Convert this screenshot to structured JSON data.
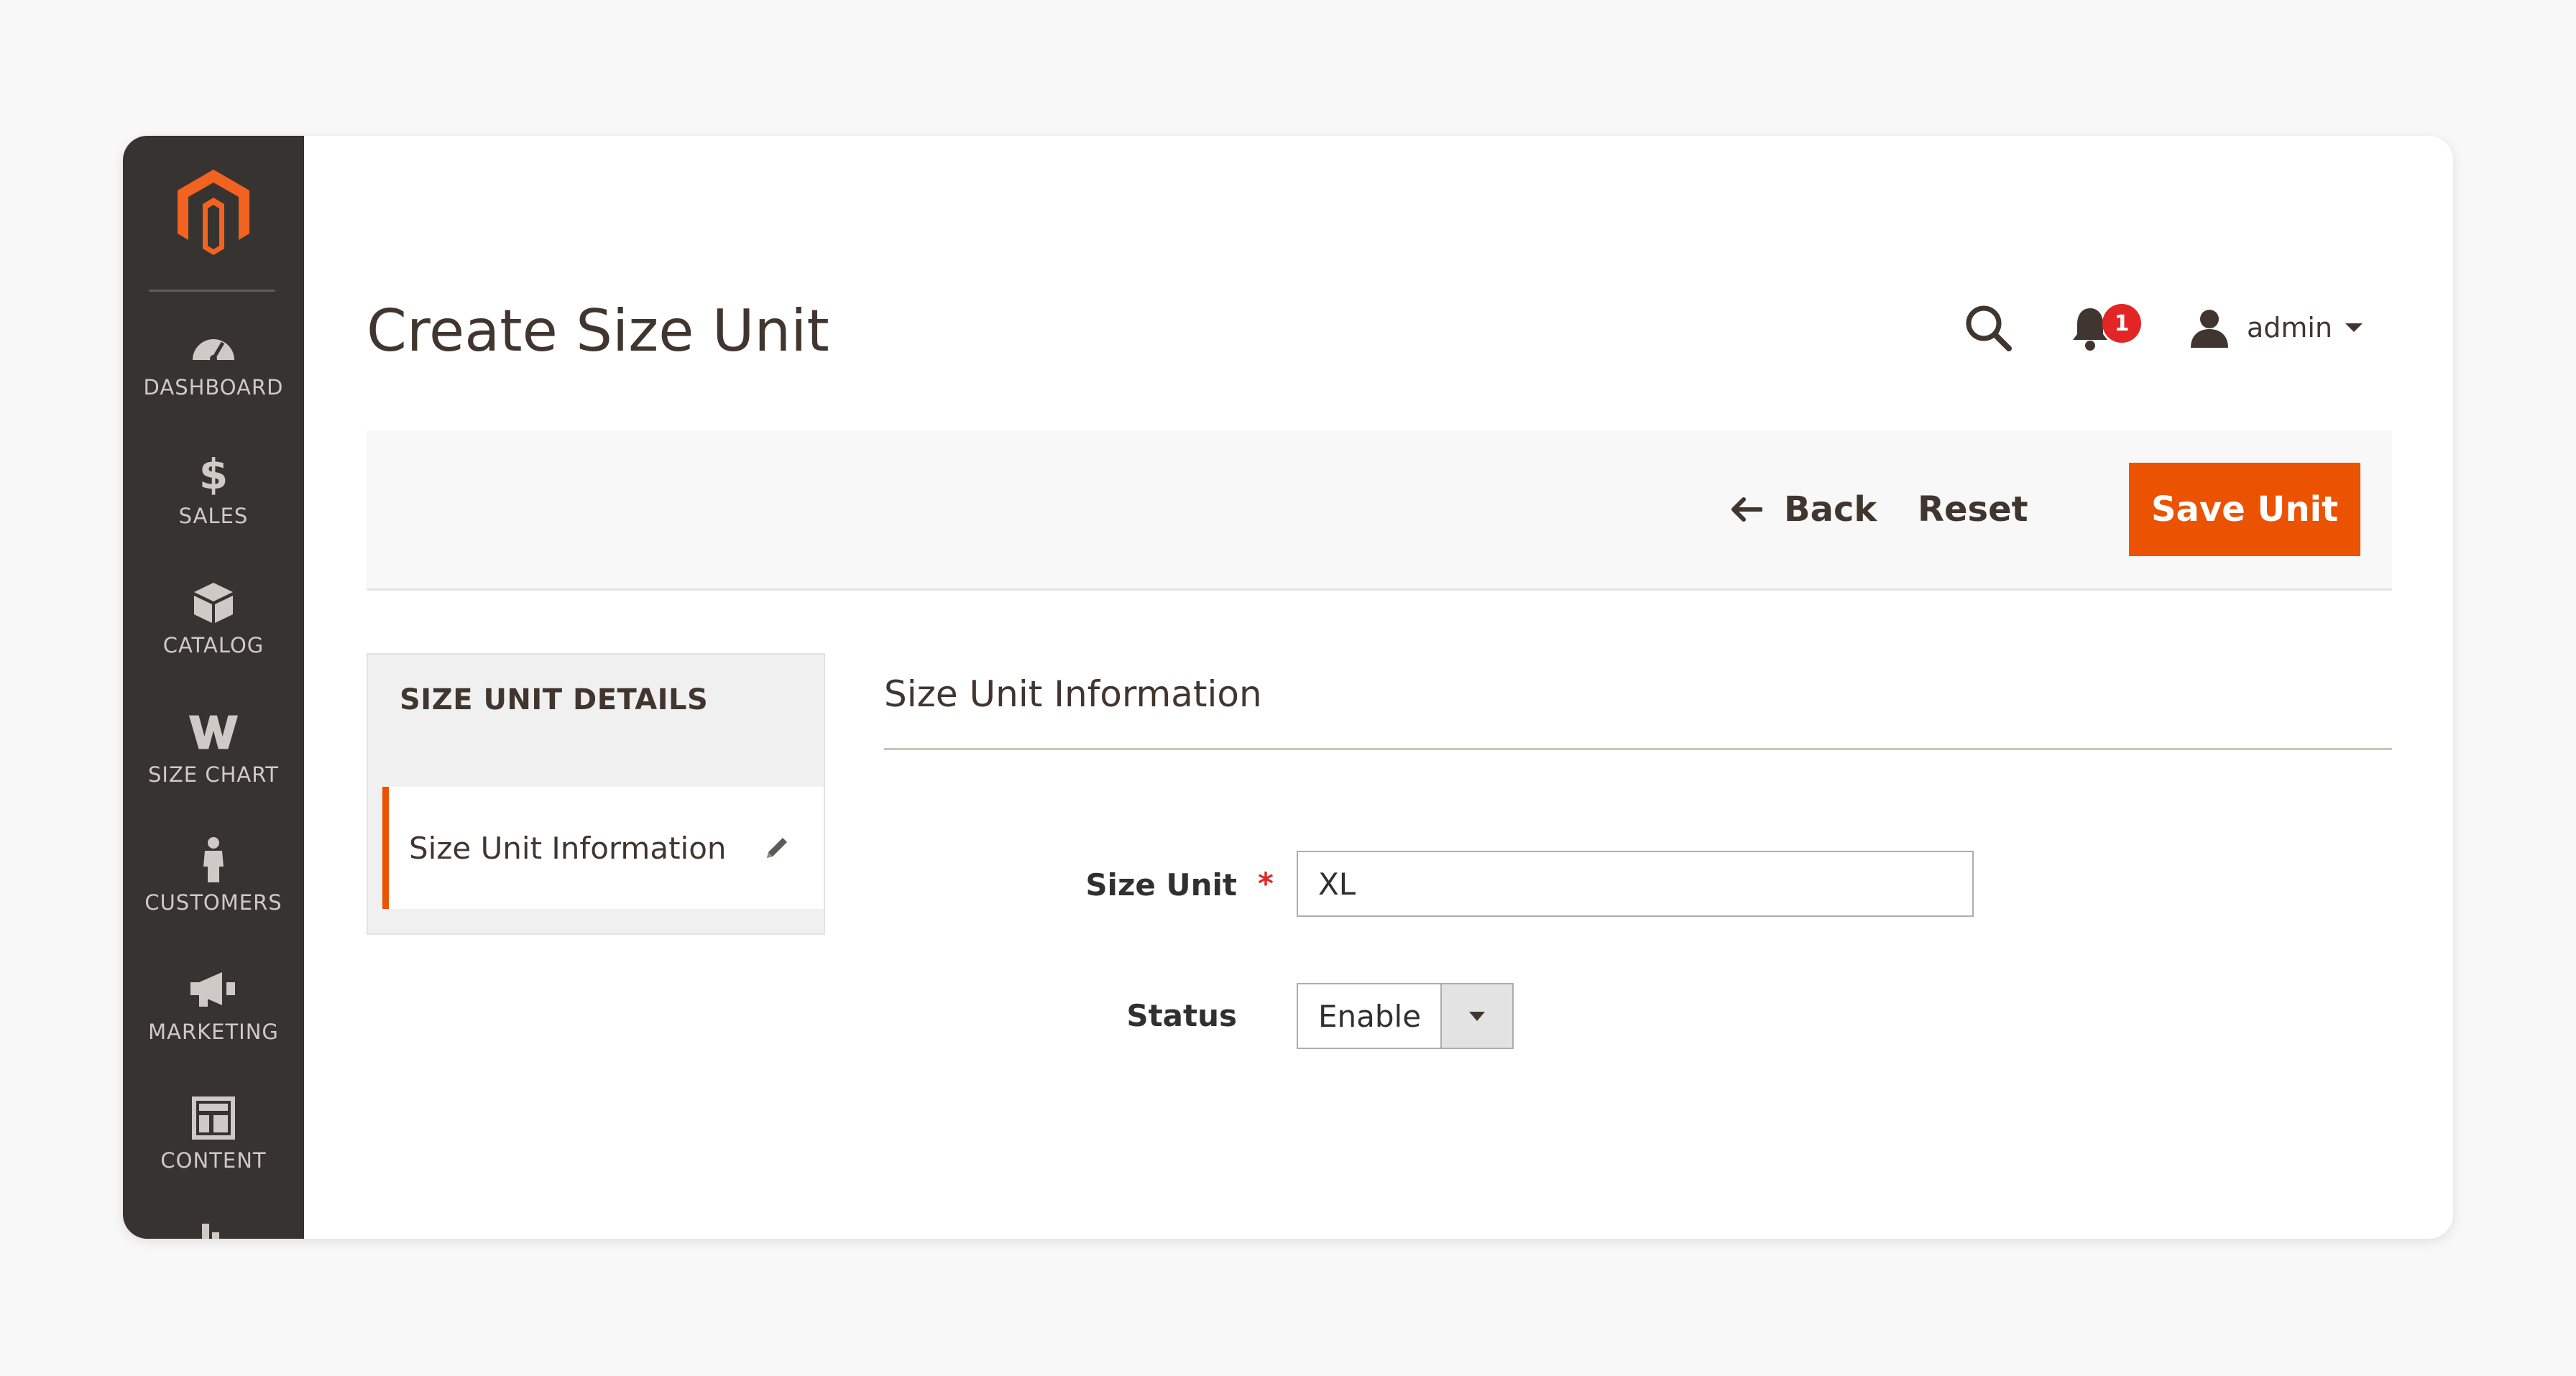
{
  "sidebar": {
    "logo": "magento-logo",
    "items": [
      {
        "label": "DASHBOARD",
        "icon": "dashboard-icon"
      },
      {
        "label": "SALES",
        "icon": "dollar-icon"
      },
      {
        "label": "CATALOG",
        "icon": "box-icon"
      },
      {
        "label": "SIZE CHART",
        "icon": "size-chart-icon"
      },
      {
        "label": "CUSTOMERS",
        "icon": "person-icon"
      },
      {
        "label": "MARKETING",
        "icon": "megaphone-icon"
      },
      {
        "label": "CONTENT",
        "icon": "layout-icon"
      }
    ]
  },
  "header": {
    "title": "Create Size Unit",
    "notifications_count": "1",
    "user_label": "admin"
  },
  "toolbar": {
    "back_label": "Back",
    "reset_label": "Reset",
    "save_label": "Save Unit"
  },
  "tabs": {
    "title": "SIZE UNIT DETAILS",
    "items": [
      {
        "label": "Size Unit Information",
        "active": true
      }
    ]
  },
  "form": {
    "section_title": "Size Unit Information",
    "size_unit": {
      "label": "Size Unit",
      "value": "XL",
      "required": true
    },
    "status": {
      "label": "Status",
      "value": "Enable"
    }
  },
  "colors": {
    "accent": "#eb5202",
    "sidebar_bg": "#373330",
    "badge": "#e22626"
  }
}
